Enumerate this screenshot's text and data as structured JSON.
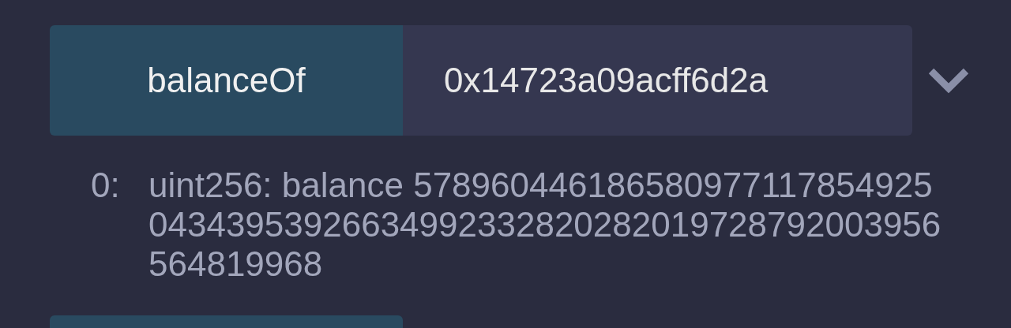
{
  "function_row": {
    "button": "balanceOf",
    "input_value": "0x14723a09acff6d2a",
    "expanded": false
  },
  "result": {
    "index": "0:",
    "value": "uint256: balance 57896044618658097711785492504343953926634992332820282019728792003956564819968"
  }
}
